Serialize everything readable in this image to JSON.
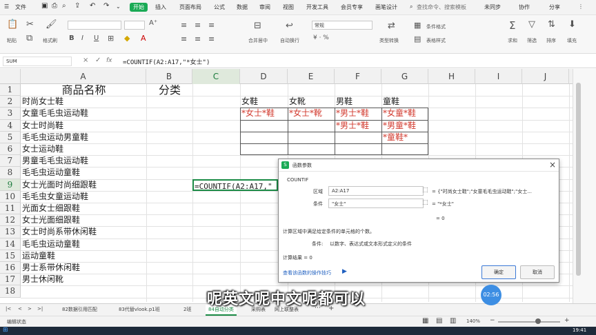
{
  "menubar": {
    "file": "文件",
    "start": "开始",
    "items": [
      "插入",
      "页面布局",
      "公式",
      "数据",
      "审阅",
      "视图",
      "开发工具",
      "会员专享",
      "画笔设计"
    ],
    "search": "查找命令、搜索模板",
    "sync": "未同步",
    "collab": "协作",
    "share": "分享"
  },
  "ribbon": {
    "paste": "粘贴",
    "format_painter": "格式刷",
    "merge": "合并居中",
    "wrap": "自动换行",
    "number_format": "常规",
    "type_convert": "类型转换",
    "cond_format": "条件格式",
    "cell_style": "表格样式",
    "sum": "求和",
    "filter": "筛选",
    "sort": "排序",
    "fill": "填充"
  },
  "formula_bar": {
    "name_box": "SUM",
    "fx": "fx",
    "formula": "=COUNTIF(A2:A17,\"*女士\")"
  },
  "columns": [
    "A",
    "B",
    "C",
    "D",
    "E",
    "F",
    "G",
    "H",
    "I",
    "J"
  ],
  "rows": [
    "1",
    "2",
    "3",
    "4",
    "5",
    "6",
    "7",
    "8",
    "9",
    "10",
    "11",
    "12",
    "13",
    "14",
    "15",
    "16",
    "17",
    "18"
  ],
  "sheet": {
    "a1": "商品名称",
    "b1": "分类",
    "colA": [
      "时尚女士鞋",
      "女童毛毛虫运动鞋",
      "女士时尚鞋",
      "毛毛虫运动男童鞋",
      "女士运动鞋",
      "男童毛毛虫运动鞋",
      "毛毛虫运动童鞋",
      "女士光面时尚细跟鞋",
      "毛毛虫女童运动鞋",
      "光面女士细跟鞋",
      "女士光面细跟鞋",
      "女士时尚系带休闲鞋",
      "毛毛虫运动童鞋",
      "运动童鞋",
      "男士系带休闲鞋",
      "男士休闲靴"
    ],
    "c9": "=COUNTIF(A2:A17,\"",
    "headers": {
      "d": "女鞋",
      "e": "女靴",
      "f": "男鞋",
      "g": "童鞋"
    },
    "d3": "*女士*鞋",
    "e3": "*女士*靴",
    "f3": "*男士*鞋",
    "f4": "*男士*鞋",
    "g3": "*女童*鞋",
    "g4": "*男童*鞋",
    "g5": "*童鞋*"
  },
  "dialog": {
    "title": "函数参数",
    "func": "COUNTIF",
    "range_label": "区域",
    "range_value": "A2:A17",
    "range_result": "= {\"时尚女士鞋\";\"女童毛毛虫运动鞋\";\"女士...",
    "criteria_label": "条件",
    "criteria_value": "\"女士\"",
    "criteria_result": "= \"*女士\"",
    "total": "= 0",
    "description": "计算区域中满足给定条件的单元格的个数。",
    "criteria_hint_label": "条件:",
    "criteria_hint": "以数字、表达式或文本形式定义的条件",
    "result": "计算结果 = 0",
    "help_link": "查看该函数的操作技巧",
    "ok": "确定",
    "cancel": "取消"
  },
  "tabs": [
    "82数据引用匹配",
    "83代替vlook.p1班",
    "2班",
    "84自动分类",
    "采购表",
    "网上联整表"
  ],
  "status": {
    "left": "编辑状态",
    "zoom": "140%"
  },
  "subtitle": "呢英文呢中文呢都可以",
  "timer": "02:56",
  "clock": "19:41"
}
